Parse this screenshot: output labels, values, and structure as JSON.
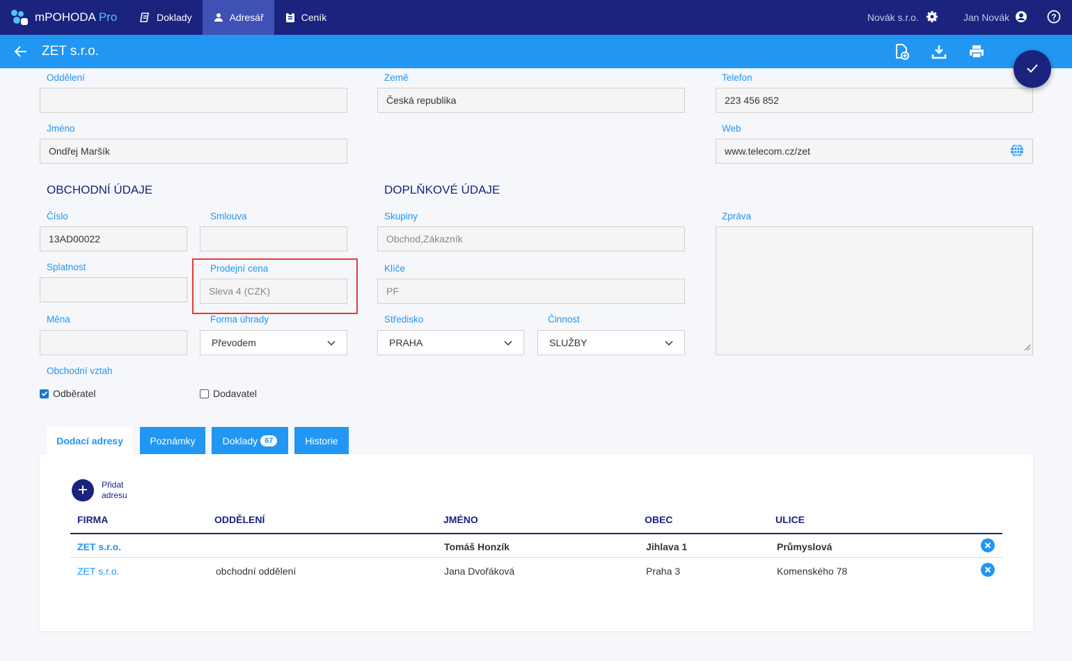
{
  "app": {
    "name": "mPOHODA",
    "edition": "Pro"
  },
  "nav": {
    "items": [
      {
        "label": "Doklady",
        "icon": "documents-icon"
      },
      {
        "label": "Adresář",
        "icon": "person-icon"
      },
      {
        "label": "Ceník",
        "icon": "clipboard-icon"
      }
    ],
    "company": "Novák s.r.o.",
    "user": "Jan Novák"
  },
  "titlebar": {
    "title": "ZET s.r.o."
  },
  "form": {
    "oddeleni": {
      "label": "Oddělení",
      "value": ""
    },
    "zeme": {
      "label": "Země",
      "value": "Česká republika"
    },
    "telefon": {
      "label": "Telefon",
      "value": "223 456 852"
    },
    "jmeno": {
      "label": "Jméno",
      "value": "Ondřej Maršík"
    },
    "web": {
      "label": "Web",
      "value": "www.telecom.cz/zet"
    },
    "section_obchodni": "OBCHODNÍ ÚDAJE",
    "section_doplnkove": "DOPLŇKOVÉ ÚDAJE",
    "cislo": {
      "label": "Číslo",
      "value": "13AD00022"
    },
    "smlouva": {
      "label": "Smlouva",
      "value": ""
    },
    "skupiny": {
      "label": "Skupiny",
      "value": "Obchod,Zákazník"
    },
    "zprava": {
      "label": "Zpráva",
      "value": ""
    },
    "splatnost": {
      "label": "Splatnost",
      "value": ""
    },
    "prodejni_cena": {
      "label": "Prodejní cena",
      "value": "Sleva 4 (CZK)"
    },
    "klice": {
      "label": "Klíče",
      "value": "PF"
    },
    "mena": {
      "label": "Měna",
      "value": ""
    },
    "forma_uhrady": {
      "label": "Forma úhrady",
      "value": "Převodem"
    },
    "stredisko": {
      "label": "Středisko",
      "value": "PRAHA"
    },
    "cinnost": {
      "label": "Činnost",
      "value": "SLUŽBY"
    },
    "obchodni_vztah": {
      "label": "Obchodní vztah"
    },
    "odberatel": {
      "label": "Odběratel",
      "checked": true
    },
    "dodavatel": {
      "label": "Dodavatel",
      "checked": false
    }
  },
  "tabs": [
    {
      "label": "Dodací adresy",
      "active": true
    },
    {
      "label": "Poznámky"
    },
    {
      "label": "Doklady",
      "badge": "67"
    },
    {
      "label": "Historie"
    }
  ],
  "addresses": {
    "add_label": "Přidat adresu",
    "columns": [
      "FIRMA",
      "ODDĚLENÍ",
      "JMÉNO",
      "OBEC",
      "ULICE"
    ],
    "rows": [
      {
        "firma": "ZET s.r.o.",
        "oddeleni": "",
        "jmeno": "Tomáš Honzík",
        "obec": "Jihlava 1",
        "ulice": "Průmyslová"
      },
      {
        "firma": "ZET s.r.o.",
        "oddeleni": "obchodní oddělení",
        "jmeno": "Jana Dvořáková",
        "obec": "Praha 3",
        "ulice": "Komenského 78"
      }
    ]
  },
  "colors": {
    "navy": "#1a237e",
    "blue": "#2196f3",
    "highlight": "#e53935"
  }
}
